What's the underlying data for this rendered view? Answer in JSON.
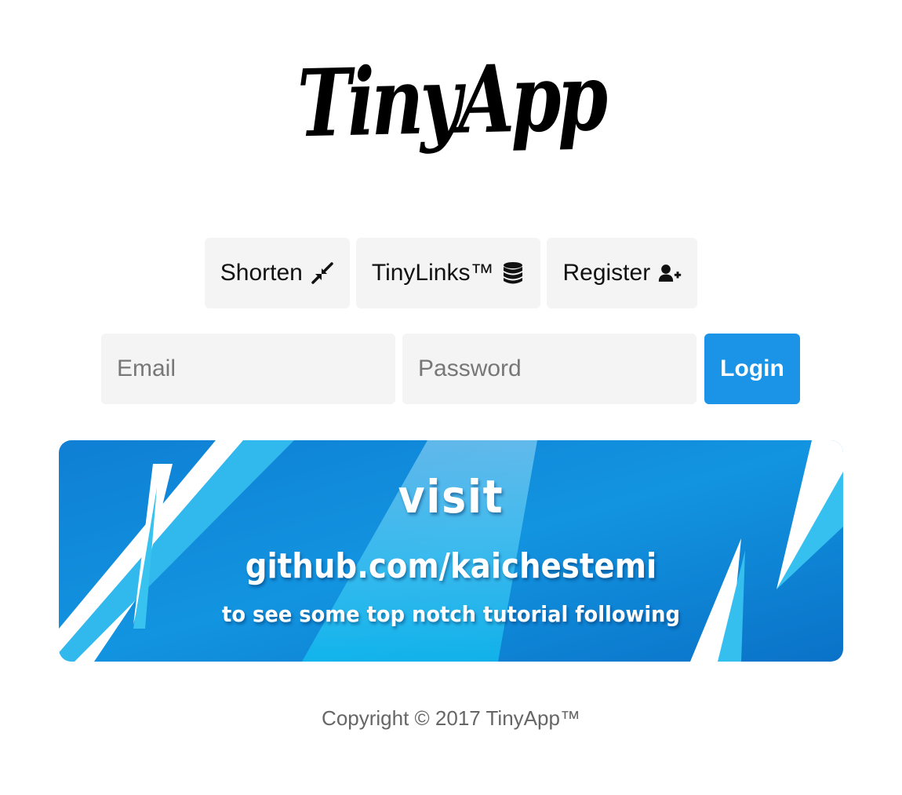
{
  "logo": {
    "text": "TinyApp"
  },
  "nav": {
    "items": [
      {
        "label": "Shorten",
        "icon": "compress-arrows-icon"
      },
      {
        "label": "TinyLinks™",
        "icon": "database-icon"
      },
      {
        "label": "Register",
        "icon": "user-plus-icon"
      }
    ]
  },
  "login": {
    "email_placeholder": "Email",
    "password_placeholder": "Password",
    "button_label": "Login"
  },
  "banner": {
    "line1": "visit",
    "line2": "github.com/kaichestemi",
    "line3": "to see some top notch tutorial following"
  },
  "footer": {
    "text": "Copyright © 2017 TinyApp™"
  },
  "colors": {
    "login_button": "#1b94e8",
    "nav_bg": "#f4f4f4",
    "banner_blue": "#0a84d8",
    "banner_light": "#29c4f2"
  }
}
